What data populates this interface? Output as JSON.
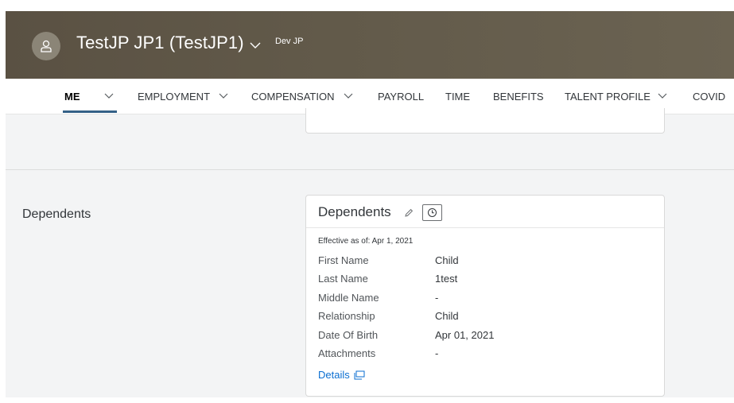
{
  "header": {
    "avatar_icon": "person-icon",
    "profile_name": "TestJP JP1 (TestJP1)",
    "instance_label": "Dev JP",
    "background_color": "#5f574a"
  },
  "nav": {
    "items": [
      {
        "label": "ME",
        "has_dropdown": true,
        "active": true
      },
      {
        "label": "EMPLOYMENT",
        "has_dropdown": true
      },
      {
        "label": "COMPENSATION",
        "has_dropdown": true
      },
      {
        "label": "PAYROLL",
        "has_dropdown": false
      },
      {
        "label": "TIME",
        "has_dropdown": false
      },
      {
        "label": "BENEFITS",
        "has_dropdown": false
      },
      {
        "label": "TALENT PROFILE",
        "has_dropdown": true
      },
      {
        "label": "COVID",
        "has_dropdown": false
      }
    ],
    "active_color": "#346187"
  },
  "dependents_section": {
    "section_label": "Dependents",
    "card": {
      "title": "Dependents",
      "edit_icon": "pencil-icon",
      "history_icon": "clock-icon",
      "effective_text": "Effective as of: Apr 1, 2021",
      "fields": [
        {
          "label": "First Name",
          "value": "Child"
        },
        {
          "label": "Last Name",
          "value": "1test"
        },
        {
          "label": "Middle Name",
          "value": "-"
        },
        {
          "label": "Relationship",
          "value": "Child"
        },
        {
          "label": "Date Of Birth",
          "value": "Apr 01, 2021"
        },
        {
          "label": "Attachments",
          "value": "-"
        }
      ],
      "details_link": "Details",
      "details_icon": "popup-icon",
      "link_color": "#0a6ed1"
    }
  }
}
